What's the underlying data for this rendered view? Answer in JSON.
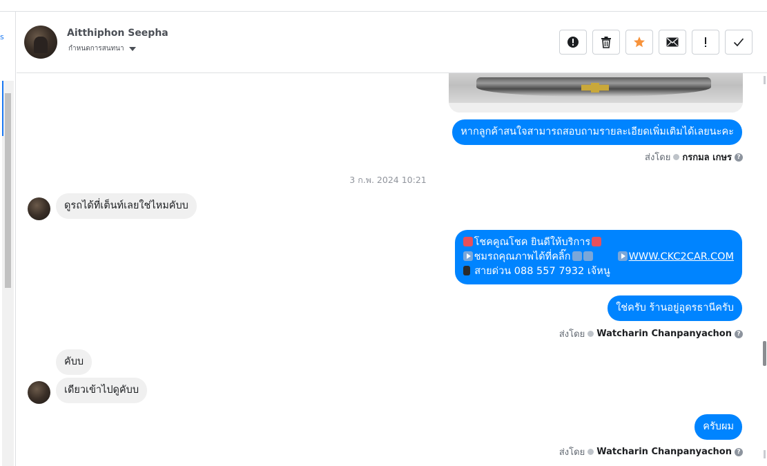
{
  "header": {
    "contact_name": "Aitthiphon Seepha",
    "subtitle": "กำหนดการสนทนา"
  },
  "toolbar": {
    "buttons": [
      {
        "name": "spam-button",
        "icon": "exclamation-circle-icon"
      },
      {
        "name": "delete-button",
        "icon": "trash-icon"
      },
      {
        "name": "star-button",
        "icon": "star-icon",
        "color": "#f7923a"
      },
      {
        "name": "mark-unread-button",
        "icon": "envelope-icon"
      },
      {
        "name": "follow-up-button",
        "icon": "exclamation-icon"
      },
      {
        "name": "done-button",
        "icon": "check-icon"
      }
    ]
  },
  "thread": {
    "msg1": "หากลูกค้าสนใจสามารถสอบถามรายละเอียดเพิ่มเติมได้เลยนะคะ",
    "sent_by_label": "ส่งโดย",
    "msg1_sender": "กรกมล เกษร",
    "timestamp": "3 ก.พ. 2024 10:21",
    "in1": "ดูรถได้ที่เต็นท์เลยใช่ไหมคับบ",
    "out2_line1": "โชคคูณโชค ยินดีให้บริการ",
    "out2_line2": "ชมรถคุณภาพได้ที่คลิ๊ก",
    "out2_link": "WWW.CKC2CAR.COM",
    "out2_line3": "สายด่วน 088 557 7932 เจ้หนู",
    "out3": "ใช่ครับ ร้านอยู่อุดรธานีครับ",
    "out3_sender": "Watcharin Chanpanyachon",
    "in2": "คับบ",
    "in3": "เดียวเข้าไปดูคับบ",
    "out4": "ครับผม",
    "out4_sender": "Watcharin Chanpanyachon"
  },
  "colors": {
    "outgoing_bubble": "#0084ff",
    "incoming_bubble": "#f0f0f0",
    "accent": "#1877f2"
  }
}
